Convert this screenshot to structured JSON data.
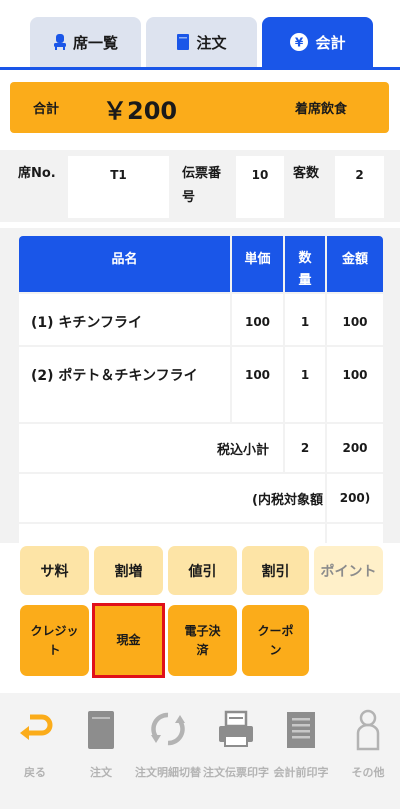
{
  "tabs": [
    {
      "label": "席一覧",
      "icon": "seat-icon",
      "active": false
    },
    {
      "label": "注文",
      "icon": "order-book-icon",
      "active": false
    },
    {
      "label": "会計",
      "icon": "yen-coin-icon",
      "active": true
    }
  ],
  "total": {
    "label": "合計",
    "amount": "￥200",
    "mode": "着席飲食"
  },
  "info": {
    "seat_label": "席No.",
    "seat_value": "T1",
    "slip_label": "伝票番号",
    "slip_value": "10",
    "guests_label": "客数",
    "guests_value": "2"
  },
  "table": {
    "headers": {
      "name": "品名",
      "price": "単価",
      "qty": "数量",
      "amount": "金額"
    },
    "rows": [
      {
        "name": "(1) キチンフライ",
        "price": "100",
        "qty": "1",
        "amount": "100"
      },
      {
        "name": "(2) ポテト＆チキンフライ",
        "price": "100",
        "qty": "1",
        "amount": "100"
      }
    ],
    "subtotal": {
      "label": "税込小計",
      "qty": "2",
      "amount": "200"
    },
    "tax_target": {
      "label": "(内税対象額",
      "amount": "200)"
    }
  },
  "actions": {
    "row1": [
      "サ料",
      "割増",
      "値引",
      "割引",
      "ポイント"
    ],
    "row2": [
      "クレジット",
      "現金",
      "電子決済",
      "クーポン"
    ]
  },
  "bottom": [
    {
      "label": "戻る",
      "icon": "return-arrow-icon"
    },
    {
      "label": "注文",
      "icon": "order-book-icon"
    },
    {
      "label": "注文明細切替",
      "icon": "refresh-icon"
    },
    {
      "label": "注文伝票印字",
      "icon": "printer-icon"
    },
    {
      "label": "会計前印字",
      "icon": "receipt-icon"
    },
    {
      "label": "その他",
      "icon": "person-icon"
    }
  ],
  "colors": {
    "accent_blue": "#1a56e8",
    "accent_orange": "#fbac1a",
    "selected_outline": "#e0101a"
  }
}
